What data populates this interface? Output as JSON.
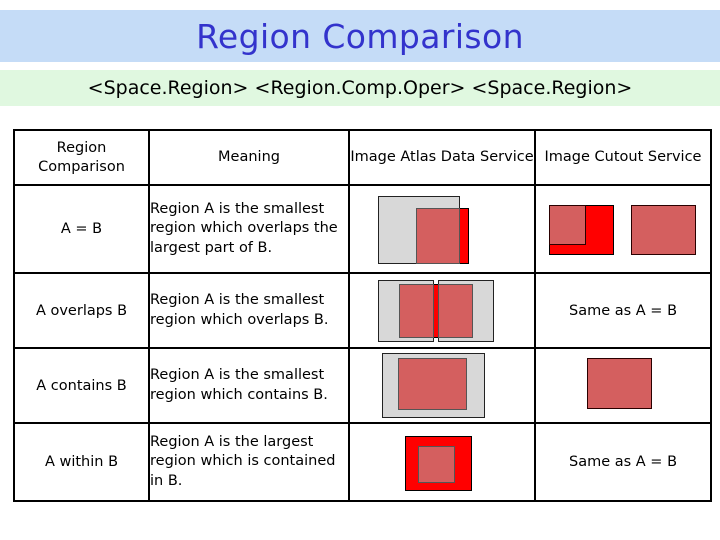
{
  "slide": {
    "title": "Region Comparison",
    "subtitle": "<Space.Region> <Region.Comp.Oper> <Space.Region>",
    "colors": {
      "title_band": "#C5DCF7",
      "title_text": "#3333CC",
      "subtitle_band": "#E0F8E0",
      "subtitle_text": "#000000",
      "region_b_gray": "#D8D8D8",
      "region_a_red": "#FF0000",
      "overlap_muted_red": "#D45F5F",
      "table_border": "#000000"
    }
  },
  "table": {
    "headers": [
      "Region Comparison",
      "Meaning",
      "Image Atlas Data Service",
      "Image Cutout Service"
    ],
    "rows": [
      {
        "operator": "A = B",
        "meaning": "Region A is the smallest region which overlaps the largest part of B.",
        "atlas_kind": "figure",
        "atlas_caption": "",
        "cutout_kind": "figure",
        "cutout_caption": ""
      },
      {
        "operator": "A overlaps B",
        "meaning": "Region A is the smallest region which overlaps B.",
        "atlas_kind": "figure",
        "atlas_caption": "",
        "cutout_kind": "text",
        "cutout_caption": "Same as A = B"
      },
      {
        "operator": "A contains B",
        "meaning": "Region A is the smallest region which contains B.",
        "atlas_kind": "figure",
        "atlas_caption": "",
        "cutout_kind": "figure",
        "cutout_caption": ""
      },
      {
        "operator": "A within B",
        "meaning": "Region A is the largest region which is contained in B.",
        "atlas_kind": "figure",
        "atlas_caption": "",
        "cutout_kind": "text",
        "cutout_caption": "Same as A = B"
      }
    ]
  }
}
